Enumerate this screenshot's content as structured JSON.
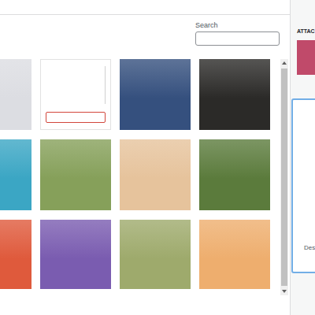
{
  "search": {
    "label": "Search",
    "value": ""
  },
  "tiles": [
    {
      "kind": "photo",
      "color": "#dcdde2"
    },
    {
      "kind": "screenshot",
      "color": "#ffffff"
    },
    {
      "kind": "photo",
      "color": "#35507e"
    },
    {
      "kind": "photo",
      "color": "#2b2a28"
    },
    {
      "kind": "photo",
      "color": "#3ba6c4"
    },
    {
      "kind": "photo",
      "color": "#86a05a"
    },
    {
      "kind": "photo",
      "color": "#e6c39c"
    },
    {
      "kind": "photo",
      "color": "#5b7b3c"
    },
    {
      "kind": "photo",
      "color": "#df5a3c"
    },
    {
      "kind": "photo",
      "color": "#7a5cb0"
    },
    {
      "kind": "photo",
      "color": "#9eaa6c"
    },
    {
      "kind": "photo",
      "color": "#eeae6e"
    }
  ],
  "sidebar": {
    "title": "ATTAC",
    "thumbnail_color": "#c04a6a",
    "field_label": "Des"
  }
}
